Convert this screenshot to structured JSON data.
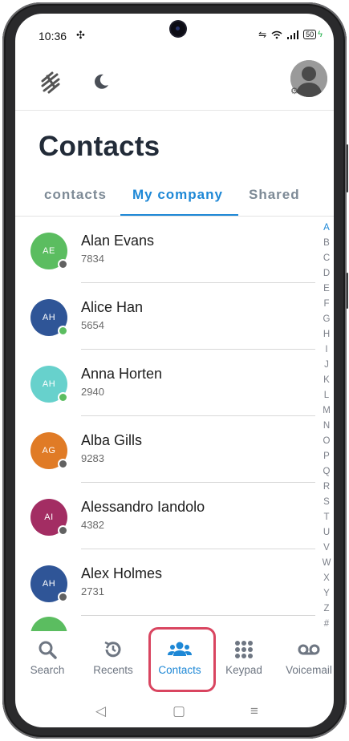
{
  "status_bar": {
    "time": "10:36",
    "battery": "50"
  },
  "page_title": "Contacts",
  "tabs": [
    {
      "label": "contacts",
      "active": false
    },
    {
      "label": "My company",
      "active": true
    },
    {
      "label": "Shared",
      "active": false
    }
  ],
  "contacts": [
    {
      "initials": "AE",
      "name": "Alan Evans",
      "ext": "7834",
      "color": "#5bbd60",
      "status": "#616161"
    },
    {
      "initials": "AH",
      "name": "Alice Han",
      "ext": "5654",
      "color": "#2f5597",
      "status": "#5bbd60"
    },
    {
      "initials": "AH",
      "name": "Anna Horten",
      "ext": "2940",
      "color": "#67d1cc",
      "status": "#5bbd60"
    },
    {
      "initials": "AG",
      "name": "Alba Gills",
      "ext": "9283",
      "color": "#e07b26",
      "status": "#616161"
    },
    {
      "initials": "AI",
      "name": "Alessandro Iandolo",
      "ext": "4382",
      "color": "#a32d63",
      "status": "#616161"
    },
    {
      "initials": "AH",
      "name": "Alex Holmes",
      "ext": "2731",
      "color": "#2f5597",
      "status": "#616161"
    }
  ],
  "alphabet": [
    "A",
    "B",
    "C",
    "D",
    "E",
    "F",
    "G",
    "H",
    "I",
    "J",
    "K",
    "L",
    "M",
    "N",
    "O",
    "P",
    "Q",
    "R",
    "S",
    "T",
    "U",
    "V",
    "W",
    "X",
    "Y",
    "Z",
    "#"
  ],
  "alphabet_active": "A",
  "bottom_nav": [
    {
      "label": "Search",
      "icon": "search-icon"
    },
    {
      "label": "Recents",
      "icon": "history-icon"
    },
    {
      "label": "Contacts",
      "icon": "people-icon",
      "active": true
    },
    {
      "label": "Keypad",
      "icon": "keypad-icon"
    },
    {
      "label": "Voicemail",
      "icon": "voicemail-icon"
    }
  ],
  "colors": {
    "accent": "#1e88d6",
    "highlight": "#d94560"
  }
}
